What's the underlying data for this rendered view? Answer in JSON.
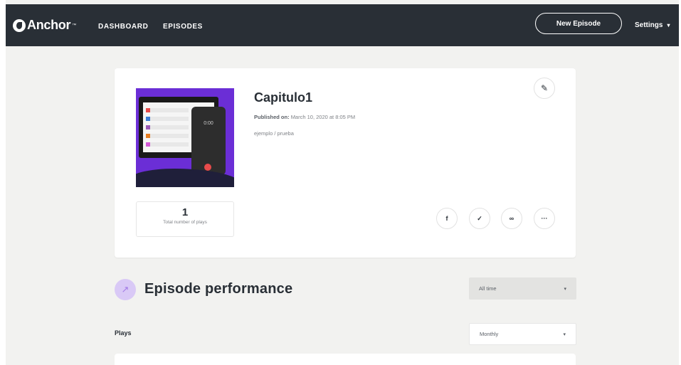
{
  "brand": {
    "name": "Anchor",
    "trademark": "™"
  },
  "nav": {
    "dashboard": "DASHBOARD",
    "episodes": "EPISODES"
  },
  "header": {
    "new_episode": "New Episode",
    "settings": "Settings"
  },
  "episode": {
    "title": "Capitulo1",
    "published_label": "Published on:",
    "published_value": "March 10, 2020 at 8:05 PM",
    "description": "ejemplo / prueba",
    "cover_time": "0:00",
    "plays_count": "1",
    "plays_label": "Total number of plays"
  },
  "share_icons": [
    "facebook-icon",
    "twitter-icon",
    "link-icon",
    "more-icon"
  ],
  "performance": {
    "title": "Episode performance",
    "range_select": "All time",
    "plays_heading": "Plays",
    "interval_select": "Monthly"
  },
  "colors": {
    "topbar": "#292f36",
    "accent_purple": "#6b2ed6",
    "icon_bg": "#d9c9f6"
  }
}
